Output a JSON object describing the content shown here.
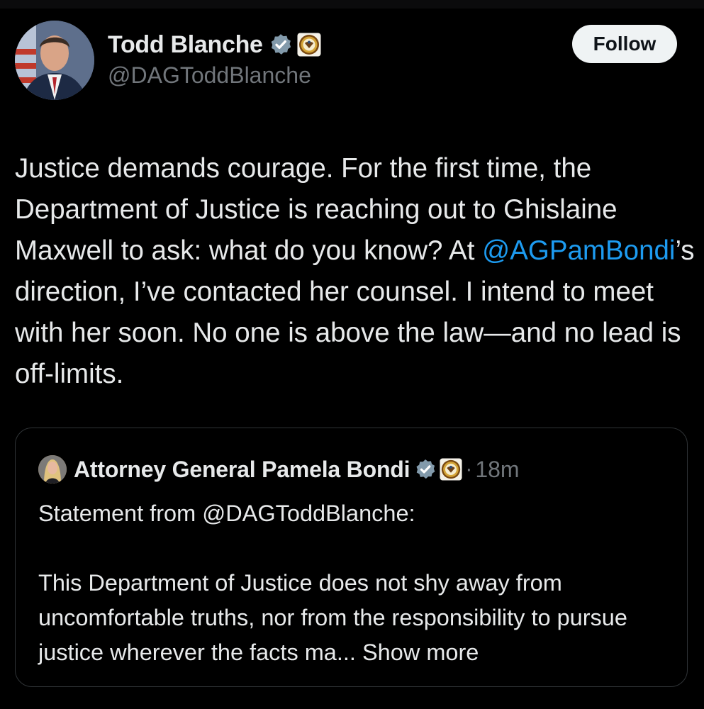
{
  "post": {
    "author_name": "Todd Blanche",
    "author_handle": "@DAGToddBlanche",
    "follow_label": "Follow",
    "text_part1": "Justice demands courage. For the first time, the Department of Justice is reaching out to Ghislaine Maxwell to ask: what do you know? At ",
    "mention": "@AGPamBondi",
    "text_part2": "’s direction, I’ve contacted her counsel. I intend to meet with her soon. No one is above the law—and no lead is off-limits."
  },
  "quoted_post": {
    "author_name": "Attorney General Pamela Bondi",
    "separator": "·",
    "timestamp": "18m",
    "line1": "Statement from @DAGToddBlanche:",
    "body": "This Department of Justice does not shy away from uncomfortable truths, nor from the responsibility to pursue justice wherever the facts ma...",
    "show_more": "Show more"
  },
  "icons": {
    "verified": "verified-badge-icon",
    "affiliate": "doj-seal-icon"
  },
  "colors": {
    "background": "#000000",
    "text": "#e7e9ea",
    "muted": "#71767b",
    "link": "#1d9bf0",
    "verified_badge": "#829aab",
    "border": "#2f3336"
  }
}
